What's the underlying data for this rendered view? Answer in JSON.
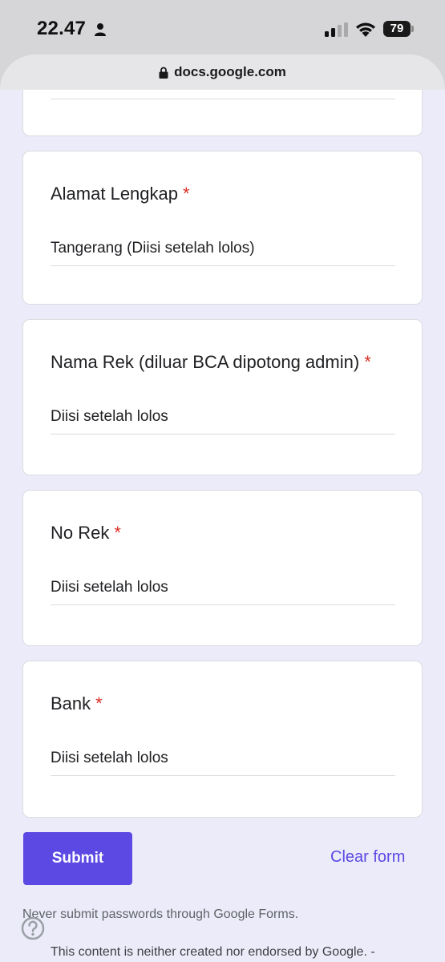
{
  "status_bar": {
    "time": "22.47",
    "battery": "79"
  },
  "browser": {
    "url": "docs.google.com"
  },
  "form": {
    "questions": [
      {
        "title": "Alamat Lengkap",
        "required": "*",
        "answer": "Tangerang (Diisi setelah lolos)"
      },
      {
        "title": "Nama Rek (diluar BCA dipotong admin)",
        "required": "*",
        "answer": "Diisi setelah lolos"
      },
      {
        "title": "No Rek",
        "required": "*",
        "answer": "Diisi setelah lolos"
      },
      {
        "title": "Bank",
        "required": "*",
        "answer": "Diisi setelah lolos"
      }
    ],
    "submit_label": "Submit",
    "clear_label": "Clear form",
    "password_warning": "Never submit passwords through Google Forms.",
    "footer_text": "This content is neither created nor endorsed by Google. -"
  },
  "colors": {
    "accent": "#5c49e3",
    "required": "#d93025",
    "page_background": "#ecebf9"
  }
}
